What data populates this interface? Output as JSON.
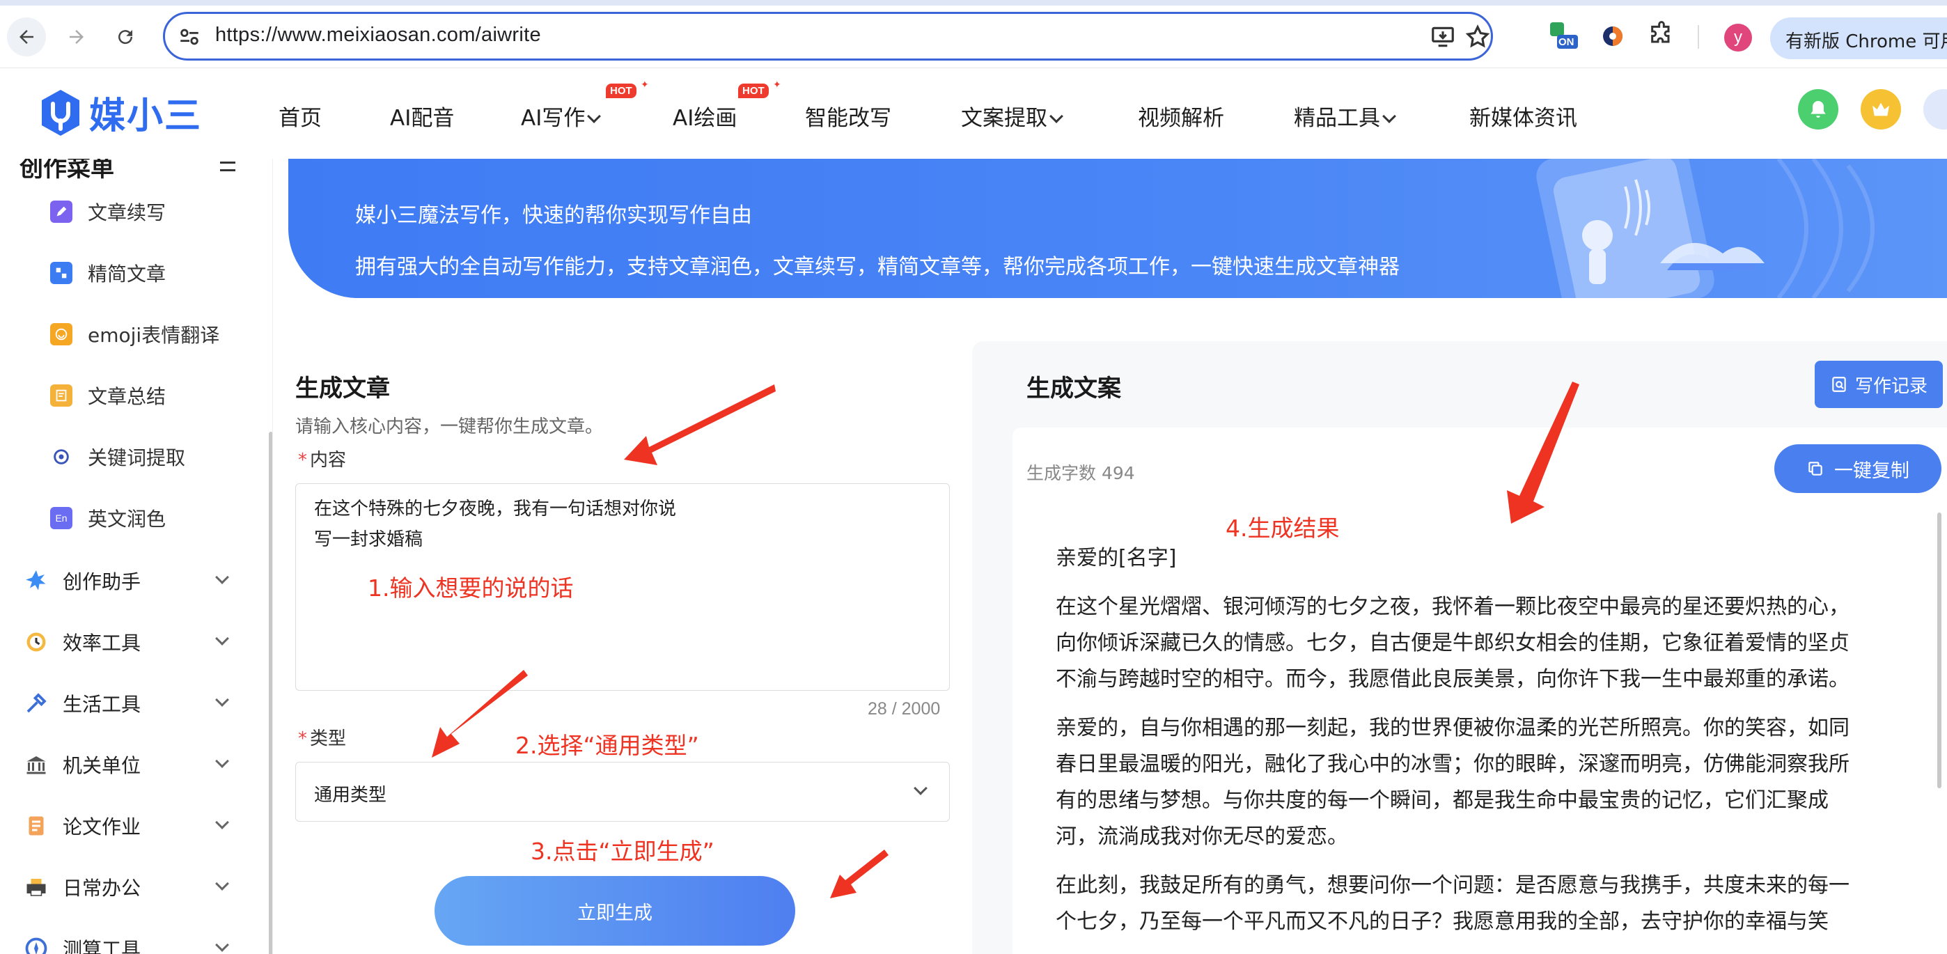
{
  "browser": {
    "url": "https://www.meixiaosan.com/aiwrite",
    "update_label": "有新版 Chrome 可用",
    "profile_initial": "y",
    "extension_badge": "ON"
  },
  "site": {
    "logo_text": "媒小三",
    "nav": [
      {
        "label": "首页"
      },
      {
        "label": "AI配音"
      },
      {
        "label": "AI写作"
      },
      {
        "label": "AI绘画"
      },
      {
        "label": "智能改写"
      },
      {
        "label": "文案提取"
      },
      {
        "label": "视频解析"
      },
      {
        "label": "精品工具"
      },
      {
        "label": "新媒体资讯"
      }
    ],
    "hot_badge": "HOT"
  },
  "sidebar": {
    "title": "创作菜单",
    "sub_items": [
      {
        "label": "文章续写"
      },
      {
        "label": "精简文章"
      },
      {
        "label": "emoji表情翻译"
      },
      {
        "label": "文章总结"
      },
      {
        "label": "关键词提取"
      },
      {
        "label": "英文润色"
      }
    ],
    "groups": [
      {
        "label": "创作助手"
      },
      {
        "label": "效率工具"
      },
      {
        "label": "生活工具"
      },
      {
        "label": "机关单位"
      },
      {
        "label": "论文作业"
      },
      {
        "label": "日常办公"
      },
      {
        "label": "测算工具"
      }
    ]
  },
  "banner": {
    "line1": "媒小三魔法写作，快速的帮你实现写作自由",
    "line2": "拥有强大的全自动写作能力，支持文章润色，文章续写，精简文章等，帮你完成各项工作，一键快速生成文章神器"
  },
  "form": {
    "title": "生成文章",
    "subtitle": "请输入核心内容，一键帮你生成文章。",
    "content_label": "内容",
    "content_lines": [
      "在这个特殊的七夕夜晚，我有一句话想对你说",
      "写一封求婚稿"
    ],
    "char_count": "28 / 2000",
    "type_label": "类型",
    "type_value": "通用类型",
    "generate_label": "立即生成",
    "required_mark": "*"
  },
  "result": {
    "title": "生成文案",
    "record_label": "写作记录",
    "word_count": "生成字数 494",
    "copy_label": "一键复制",
    "paragraphs": [
      [
        "亲爱的[名字]"
      ],
      [
        "在这个星光熠熠、银河倾泻的七夕之夜，我怀着一颗比夜空中最亮的星还要炽热的心，",
        "向你倾诉深藏已久的情感。七夕，自古便是牛郎织女相会的佳期，它象征着爱情的坚贞",
        "不渝与跨越时空的相守。而今，我愿借此良辰美景，向你许下我一生中最郑重的承诺。"
      ],
      [
        "亲爱的，自与你相遇的那一刻起，我的世界便被你温柔的光芒所照亮。你的笑容，如同",
        "春日里最温暖的阳光，融化了我心中的冰雪；你的眼眸，深邃而明亮，仿佛能洞察我所",
        "有的思绪与梦想。与你共度的每一个瞬间，都是我生命中最宝贵的记忆，它们汇聚成",
        "河，流淌成我对你无尽的爱恋。"
      ],
      [
        "在此刻，我鼓足所有的勇气，想要问你一个问题：是否愿意与我携手，共度未来的每一",
        "个七夕，乃至每一个平凡而又不凡的日子？我愿意用我的全部，去守护你的幸福与笑"
      ]
    ]
  },
  "annotations": {
    "step1": "1.输入想要的说的话",
    "step2": "2.选择“通用类型”",
    "step3": "3.点击“立即生成”",
    "step4": "4.生成结果"
  },
  "colors": {
    "accent": "#4a7ff0",
    "annotation": "#ee3322",
    "banner": "#4a86f6"
  }
}
